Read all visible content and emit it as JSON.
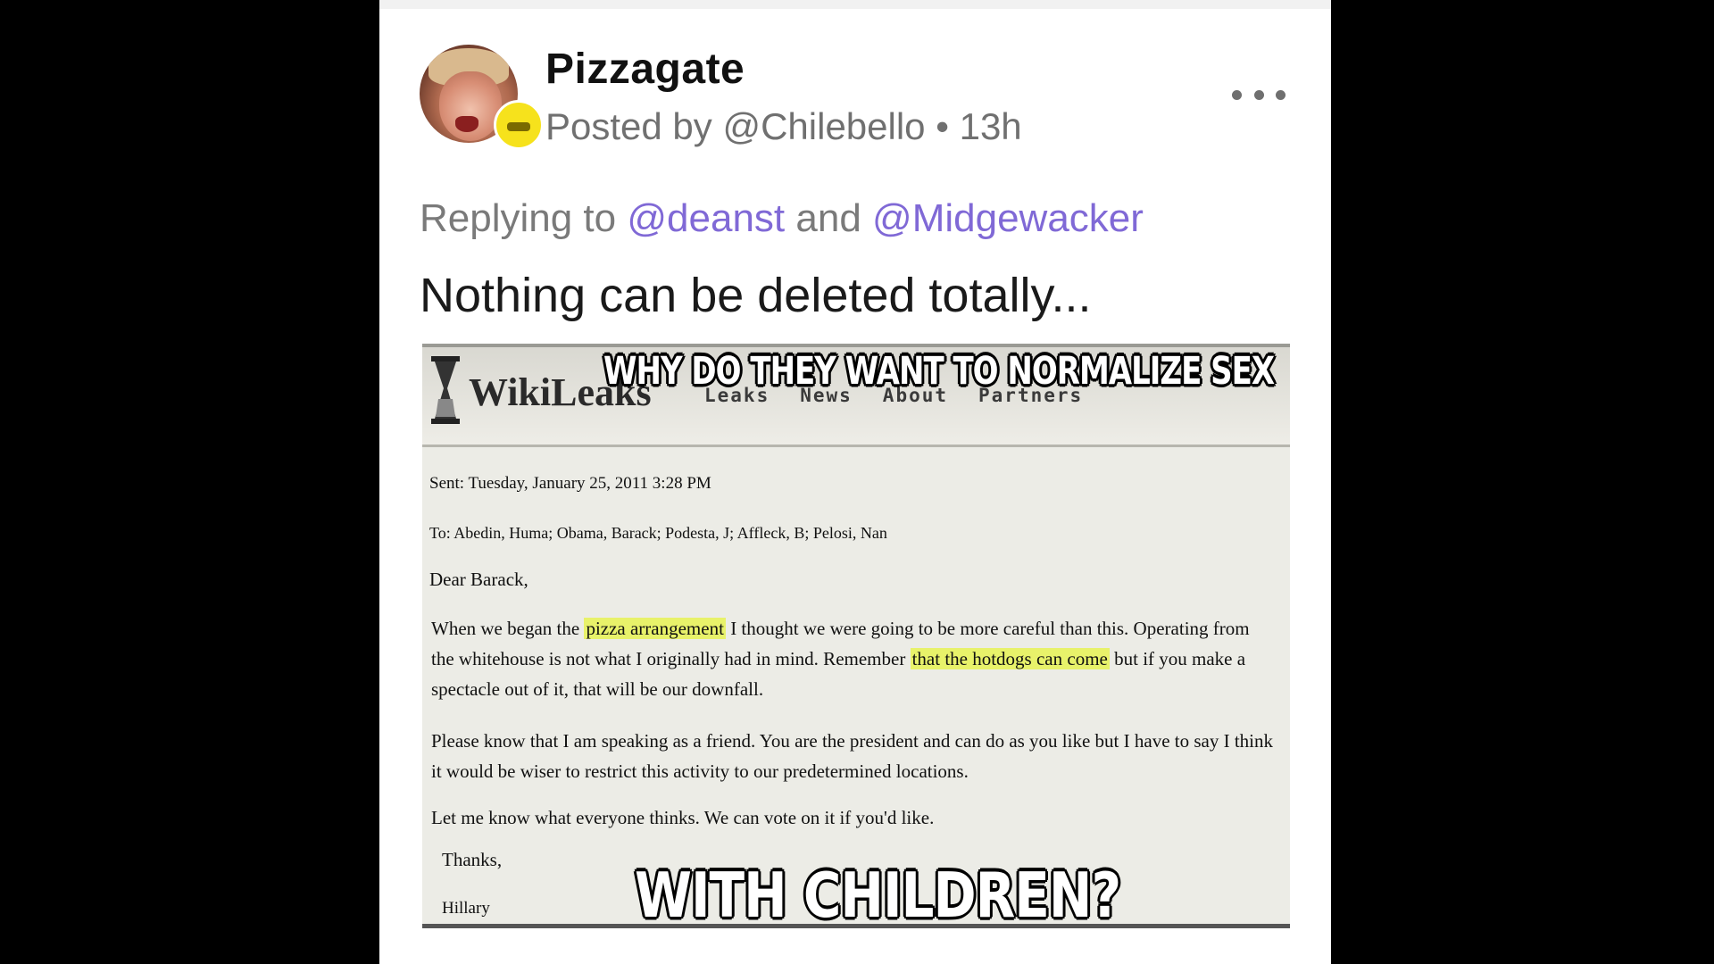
{
  "post": {
    "community": "Pizzagate",
    "byline": "Posted by @Chilebello • 13h",
    "replying_prefix": "Replying to",
    "mention_1": "@deanst",
    "replying_and": "and",
    "mention_2": "@Midgewacker",
    "text": "Nothing can be deleted totally..."
  },
  "meme": {
    "caption_top": "WHY DO THEY WANT TO NORMALIZE SEX",
    "caption_bottom": "WITH CHILDREN?",
    "logo": "WikiLeaks",
    "nav": [
      "Leaks",
      "News",
      "About",
      "Partners"
    ],
    "email": {
      "sent": "Sent: Tuesday, January 25, 2011 3:28 PM",
      "to": "To: Abedin, Huma; Obama, Barack; Podesta, J; Affleck, B; Pelosi, Nan",
      "salutation": "Dear Barack,",
      "p1_a": "When we began the",
      "p1_hl1": "pizza arrangement",
      "p1_b": "I thought we were going to be more careful than this. Operating from the whitehouse is not what I originally had in mind. Remember",
      "p1_hl2": "that the hotdogs can come",
      "p1_c": "but if you make a spectacle out of it, that will be our downfall.",
      "p2": "Please know that I am speaking as a friend. You are the president and can do as you like but I have to say I think it would be wiser to restrict this activity to our predetermined locations.",
      "p3": "Let me know what everyone thinks. We can vote on it if you'd like.",
      "signoff": "Thanks,",
      "signature": "Hillary"
    }
  },
  "colors": {
    "mention": "#8069d6",
    "highlight": "#e8f26a",
    "badge": "#f6e21c"
  },
  "icons": {
    "more": "more-dots-icon",
    "avatar_badge": "community-badge-icon",
    "logo": "hourglass-icon"
  }
}
